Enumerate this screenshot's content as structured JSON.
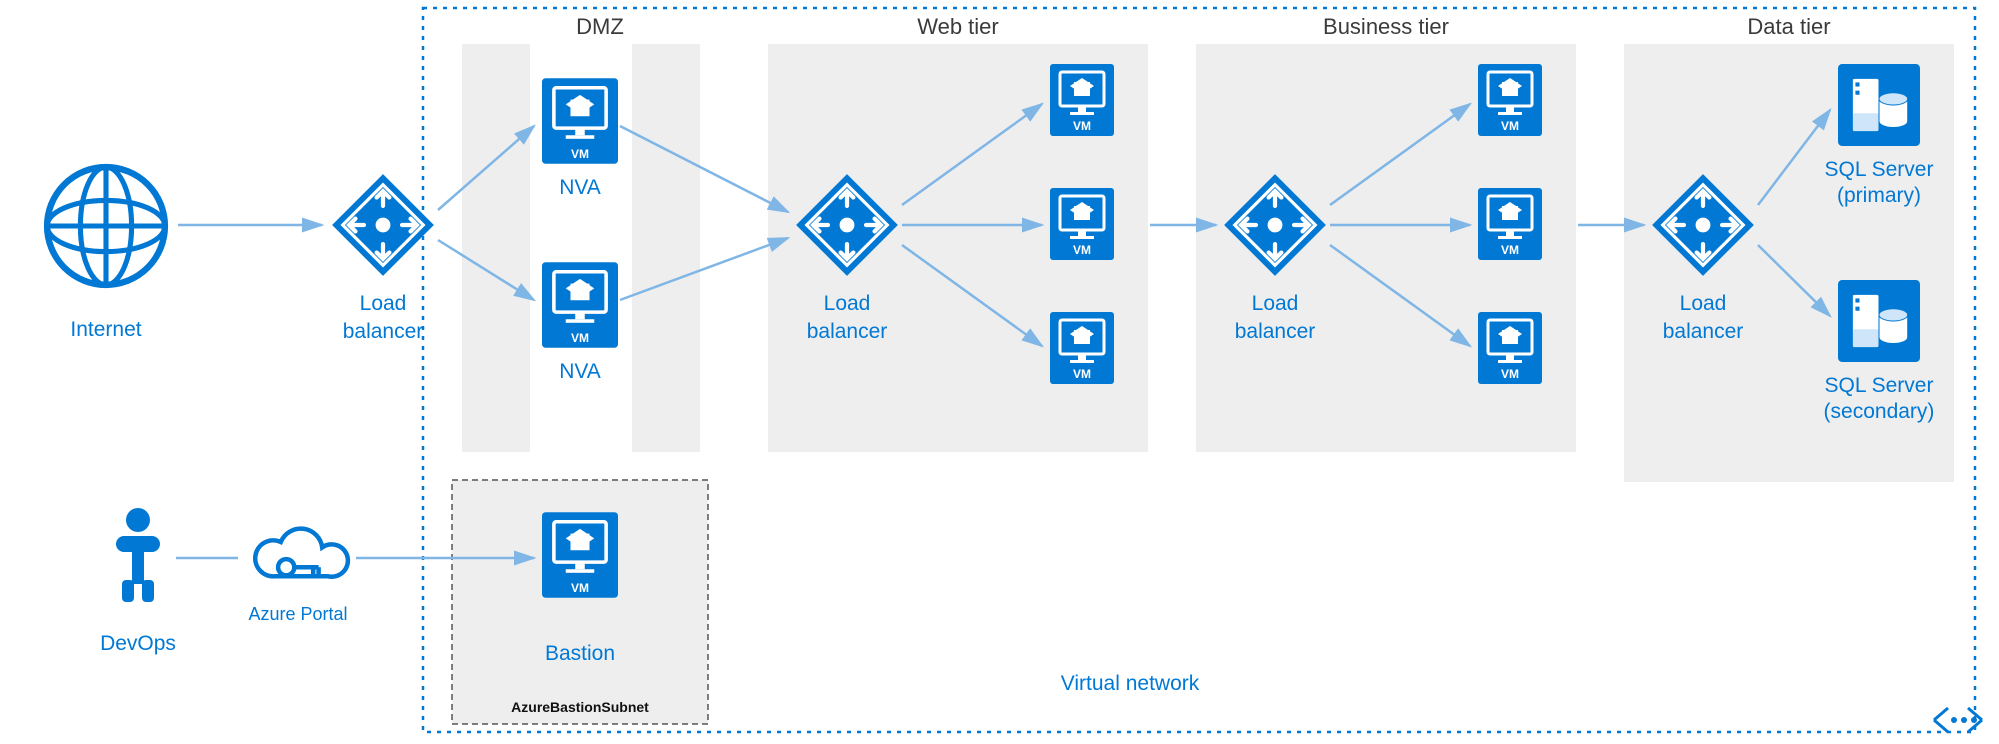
{
  "internet": {
    "label": "Internet"
  },
  "devops": {
    "label": "DevOps"
  },
  "azure_portal": {
    "label": "Azure Portal"
  },
  "vnet": {
    "label": "Virtual network"
  },
  "tiers": {
    "dmz": {
      "label": "DMZ"
    },
    "web": {
      "label": "Web tier"
    },
    "biz": {
      "label": "Business tier"
    },
    "data": {
      "label": "Data tier"
    }
  },
  "lb": {
    "label1": "Load",
    "label2": "balancer"
  },
  "nva": {
    "label": "NVA"
  },
  "sql": {
    "primary1": "SQL Server",
    "primary2": "(primary)",
    "secondary1": "SQL Server",
    "secondary2": "(secondary)"
  },
  "bastion": {
    "label": "Bastion",
    "subnet": "AzureBastionSubnet"
  },
  "vm_caption": "VM"
}
